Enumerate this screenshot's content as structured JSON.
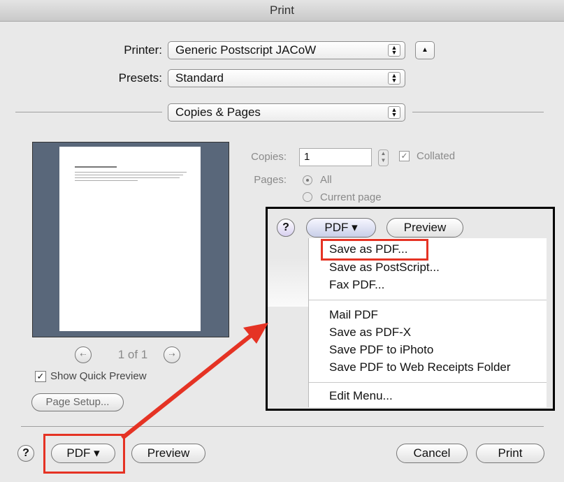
{
  "window": {
    "title": "Print"
  },
  "printer": {
    "label": "Printer:",
    "value": "Generic Postscript JACoW"
  },
  "presets": {
    "label": "Presets:",
    "value": "Standard"
  },
  "section": {
    "value": "Copies & Pages"
  },
  "copies": {
    "label": "Copies:",
    "value": "1",
    "collated_label": "Collated",
    "collated_checked": true
  },
  "pages": {
    "label": "Pages:",
    "option_all": "All",
    "option_current": "Current page"
  },
  "preview_nav": {
    "page_indicator": "1 of 1"
  },
  "quick_preview": {
    "label": "Show Quick Preview",
    "checked": true
  },
  "page_setup": {
    "label": "Page Setup..."
  },
  "callout": {
    "help": "?",
    "pdf_label": "PDF ▾",
    "preview_label": "Preview",
    "menu": {
      "group1": [
        "Save as PDF...",
        "Save as PostScript...",
        "Fax PDF..."
      ],
      "group2": [
        "Mail PDF",
        "Save as PDF-X",
        "Save PDF to iPhoto",
        "Save PDF to Web Receipts Folder"
      ],
      "group3": [
        "Edit Menu..."
      ]
    }
  },
  "footer": {
    "help": "?",
    "pdf_label": "PDF ▾",
    "preview_label": "Preview",
    "cancel_label": "Cancel",
    "print_label": "Print"
  },
  "colors": {
    "annotation_red": "#e53324",
    "preview_bg": "#59677a"
  }
}
